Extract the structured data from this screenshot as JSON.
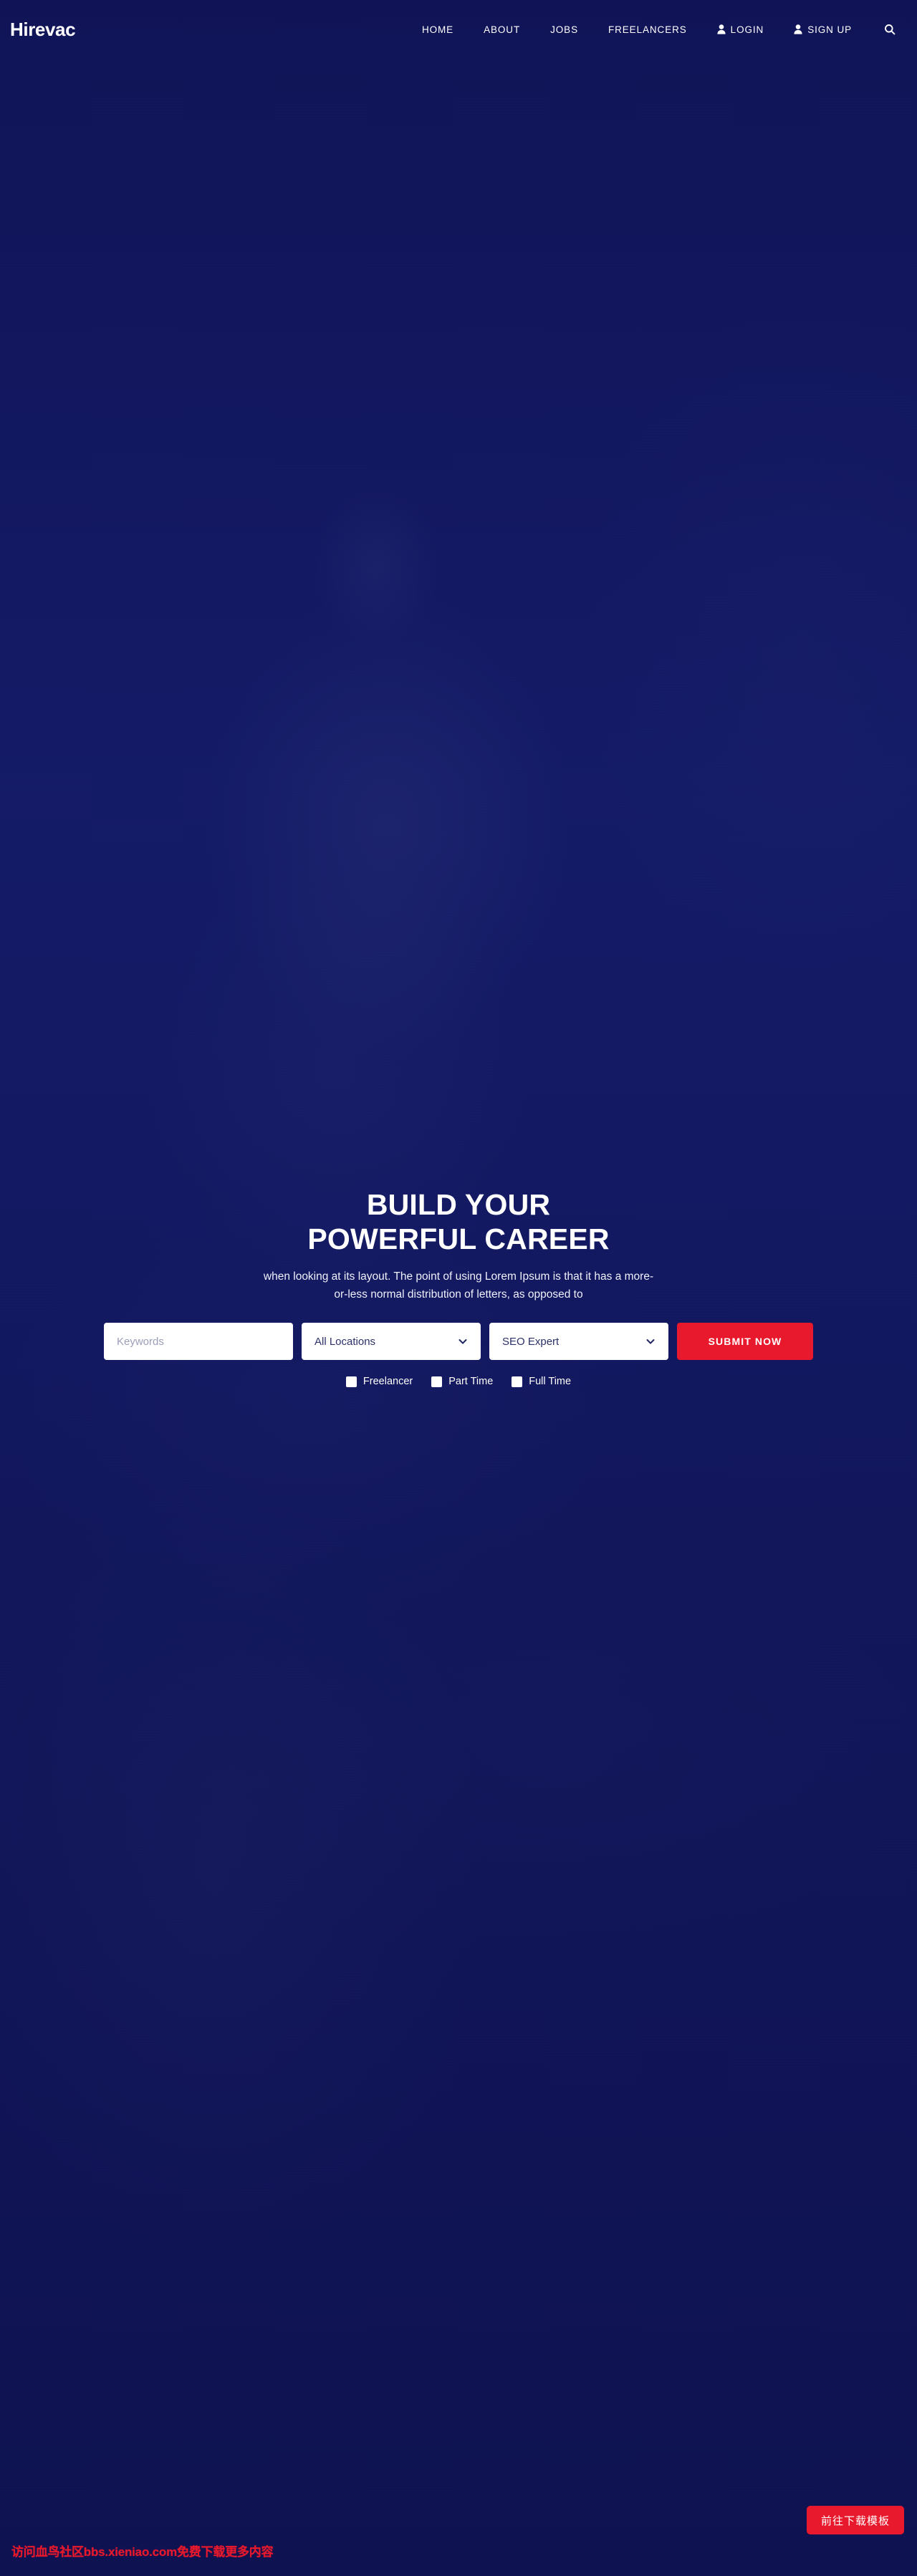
{
  "header": {
    "logo": "Hirevac",
    "nav": [
      {
        "label": "HOME",
        "icon": null
      },
      {
        "label": "ABOUT",
        "icon": null
      },
      {
        "label": "JOBS",
        "icon": null
      },
      {
        "label": "FREELANCERS",
        "icon": null
      },
      {
        "label": "LOGIN",
        "icon": "user-icon"
      },
      {
        "label": "SIGN UP",
        "icon": "user-plus-icon"
      }
    ],
    "search_icon": "search-icon"
  },
  "hero": {
    "title_line_1": "BUILD YOUR",
    "title_line_2": "POWERFUL CAREER",
    "subtitle_line_1": "when looking at its layout. The point of using Lorem Ipsum is that it has a more-",
    "subtitle_line_2": "or-less normal distribution of letters, as opposed to"
  },
  "search_form": {
    "keywords_placeholder": "Keywords",
    "keywords_value": "",
    "location_selected": "All Locations",
    "category_selected": "SEO Expert",
    "submit_label": "SUBMIT NOW",
    "caret_icon": "chevron-down-icon",
    "job_types": [
      {
        "label": "Freelancer",
        "checked": false
      },
      {
        "label": "Part Time",
        "checked": false
      },
      {
        "label": "Full Time",
        "checked": false
      }
    ]
  },
  "watermark": {
    "text": "访问血鸟社区bbs.xieniao.com免费下载更多内容",
    "button_label": "前往下载模板"
  },
  "colors": {
    "background_navy": "#101458",
    "accent_red": "#e8192c",
    "text_white": "#ffffff",
    "placeholder_grey": "#9a9eb8",
    "select_text": "#2c3168"
  }
}
